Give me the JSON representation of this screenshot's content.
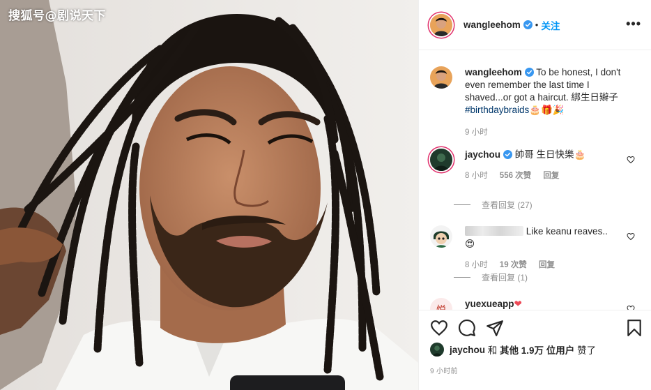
{
  "watermark": "搜狐号@剧说天下",
  "post": {
    "username": "wangleehom",
    "follow_label": "关注",
    "more_label": "•••",
    "caption_text": " To be honest, I don't even remember the last time I shaved...or got a haircut. 綁生日辮子",
    "caption_hashtag": "#birthdaybraids",
    "caption_emoji": "🎂🎁🎉",
    "caption_time": "9 小时"
  },
  "comments": [
    {
      "username": "jaychou",
      "text": " 帥哥 生日快樂🎂",
      "time": "8 小时",
      "likes": "556 次赞",
      "reply": "回复",
      "view_replies": "查看回复 (27)"
    },
    {
      "username": "",
      "text": " Like keanu reaves..😍",
      "time": "8 小时",
      "likes": "19 次赞",
      "reply": "回复",
      "view_replies": "查看回复 (1)"
    },
    {
      "username": "yuexueapp",
      "text": "❤"
    }
  ],
  "likes_bar": {
    "liker": "jaychou",
    "text_and": " 和 ",
    "text_count": "其他 1.9万 位用户",
    "text_suffix": " 赞了"
  },
  "posted_ago": "9 小时前",
  "colors": {
    "accent": "#0095f6",
    "hashtag": "#00376b",
    "muted": "#8e8e8e",
    "verified": "#3897f0",
    "heart_red": "#ed4956"
  },
  "icons": [
    "heart-icon",
    "comment-icon",
    "share-icon",
    "bookmark-icon",
    "verified-icon",
    "more-icon"
  ]
}
